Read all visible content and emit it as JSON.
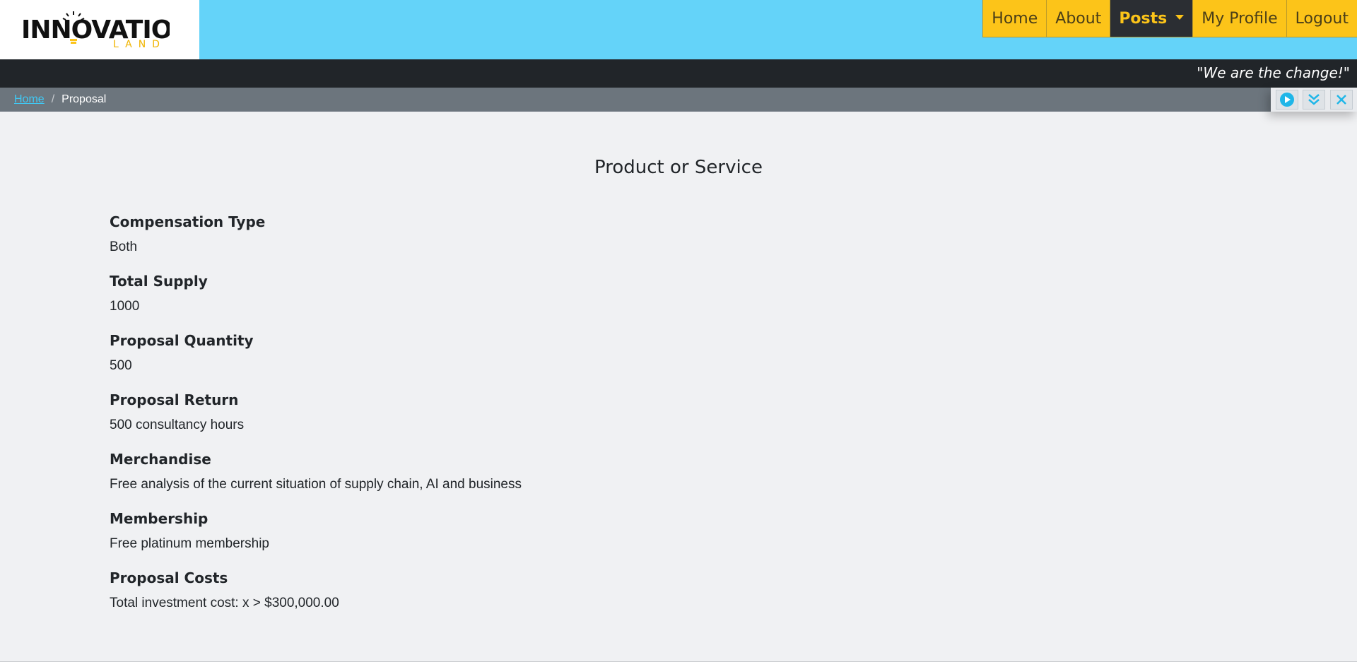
{
  "brand": {
    "logo_main": "INNOVATION",
    "logo_sub": "LAND"
  },
  "nav": {
    "items": [
      {
        "label": "Home"
      },
      {
        "label": "About"
      },
      {
        "label": "Posts",
        "active": true
      },
      {
        "label": "My Profile"
      },
      {
        "label": "Logout"
      }
    ]
  },
  "slogan": "\"We are the change!\"",
  "breadcrumb": {
    "home": "Home",
    "separator": "/",
    "current": "Proposal"
  },
  "controls": [
    "play-icon",
    "double-chevron-down-icon",
    "close-icon"
  ],
  "page": {
    "title": "Product or Service",
    "fields": [
      {
        "label": "Compensation Type",
        "value": "Both"
      },
      {
        "label": "Total Supply",
        "value": "1000"
      },
      {
        "label": "Proposal Quantity",
        "value": "500"
      },
      {
        "label": "Proposal Return",
        "value": "500 consultancy hours"
      },
      {
        "label": "Merchandise",
        "value": "Free analysis of the current situation of supply chain, AI and business"
      },
      {
        "label": "Membership",
        "value": "Free platinum membership"
      },
      {
        "label": "Proposal Costs",
        "value": "Total investment cost: x > $300,000.00"
      }
    ]
  },
  "colors": {
    "header_bg": "#64d3f9",
    "nav_bg": "#fcc419",
    "nav_active_bg": "#2b2e33",
    "slogan_bg": "#212529",
    "breadcrumb_bg": "#6c757d",
    "accent": "#1fb6e8",
    "page_bg": "#f0f1f3"
  }
}
